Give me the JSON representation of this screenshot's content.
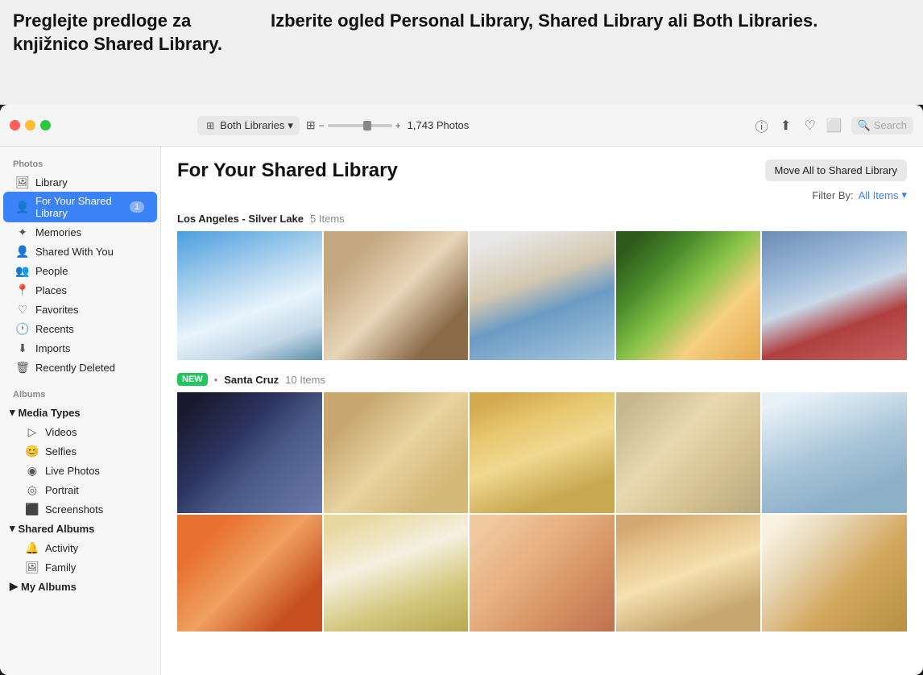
{
  "tooltip": {
    "left": "Preglejte predloge za knjižnico Shared Library.",
    "right": "Izberite ogled Personal Library, Shared Library ali Both Libraries."
  },
  "titlebar": {
    "library_selector": "Both Libraries",
    "photo_count": "1,743 Photos",
    "search_placeholder": "Search"
  },
  "sidebar": {
    "photos_section": "Photos",
    "items_photos": [
      {
        "id": "library",
        "label": "Library",
        "icon": "🖼"
      },
      {
        "id": "for-your-shared-library",
        "label": "For Your Shared Library",
        "icon": "👤",
        "badge": "1",
        "active": true
      },
      {
        "id": "memories",
        "label": "Memories",
        "icon": "✦"
      },
      {
        "id": "shared-with-you",
        "label": "Shared With You",
        "icon": "👤"
      },
      {
        "id": "people",
        "label": "People",
        "icon": "👥"
      },
      {
        "id": "places",
        "label": "Places",
        "icon": "📍"
      },
      {
        "id": "favorites",
        "label": "Favorites",
        "icon": "♡"
      },
      {
        "id": "recents",
        "label": "Recents",
        "icon": "🕐"
      },
      {
        "id": "imports",
        "label": "Imports",
        "icon": "⬇"
      },
      {
        "id": "recently-deleted",
        "label": "Recently Deleted",
        "icon": "🗑"
      }
    ],
    "albums_section": "Albums",
    "media_types_label": "Media Types",
    "media_types_items": [
      {
        "id": "videos",
        "label": "Videos",
        "icon": "▷"
      },
      {
        "id": "selfies",
        "label": "Selfies",
        "icon": "😊"
      },
      {
        "id": "live-photos",
        "label": "Live Photos",
        "icon": "◉"
      },
      {
        "id": "portrait",
        "label": "Portrait",
        "icon": "◎"
      },
      {
        "id": "screenshots",
        "label": "Screenshots",
        "icon": "⬛"
      }
    ],
    "shared_albums_label": "Shared Albums",
    "shared_albums_items": [
      {
        "id": "activity",
        "label": "Activity",
        "icon": "🔔"
      },
      {
        "id": "family",
        "label": "Family",
        "icon": "🖼"
      }
    ],
    "my_albums_label": "My Albums"
  },
  "content": {
    "title": "For Your Shared Library",
    "move_all_btn": "Move All to Shared Library",
    "filter_label": "Filter By: All Items",
    "section1": {
      "location": "Los Angeles - Silver Lake",
      "count": "5 Items"
    },
    "section2": {
      "new_badge": "NEW",
      "location": "Santa Cruz",
      "count": "10 Items"
    }
  },
  "photo_colors": {
    "row1": [
      "pc-blue",
      "pc-warm",
      "pc-red",
      "pc-green",
      "pc-sky"
    ],
    "row2_a": [
      "pc-dark",
      "pc-orange",
      "pc-teal",
      "pc-brown",
      "pc-grey"
    ],
    "row2_b": [
      "pc-navy",
      "pc-rust",
      "pc-mauve",
      "pc-tan",
      "pc-white-blue"
    ],
    "row2_c": [
      "pc-cream",
      "pc-orange",
      "pc-pink",
      "pc-warm",
      "pc-green"
    ]
  }
}
